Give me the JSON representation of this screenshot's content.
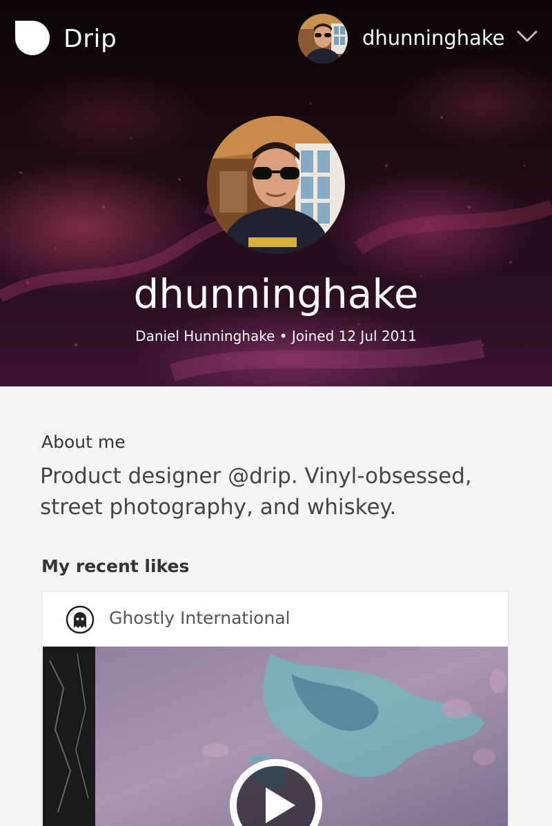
{
  "app": {
    "brand": "Drip"
  },
  "nav": {
    "username": "dhunninghake"
  },
  "profile": {
    "username": "dhunninghake",
    "meta": "Daniel Hunninghake • Joined 12 Jul 2011"
  },
  "about": {
    "heading": "About me",
    "text": "Product designer @drip. Vinyl-obsessed, street photography, and whiskey."
  },
  "likes": {
    "heading": "My recent likes",
    "items": [
      {
        "artist": "Ghostly International"
      }
    ]
  },
  "colors": {
    "hero_accent": "#c4466e",
    "page_bg": "#f5f5f5"
  }
}
